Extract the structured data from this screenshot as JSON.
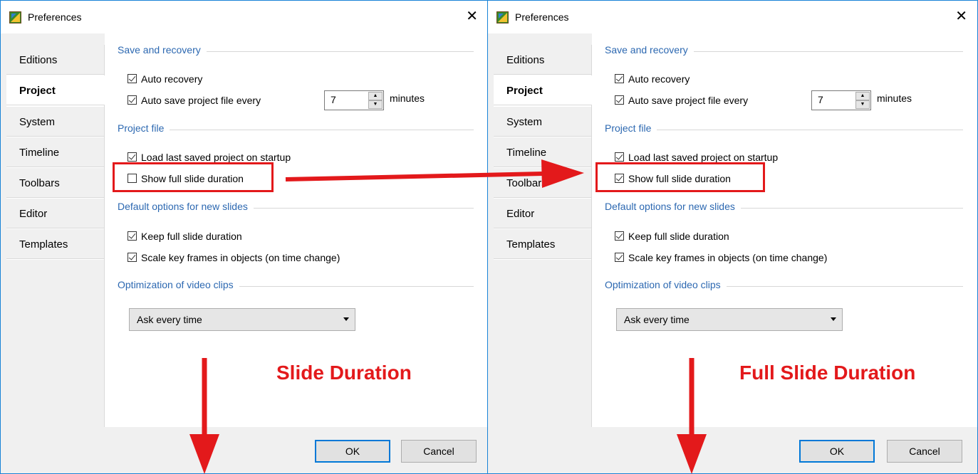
{
  "dialogs": [
    {
      "title": "Preferences",
      "tabs": [
        "Editions",
        "Project",
        "System",
        "Timeline",
        "Toolbars",
        "Editor",
        "Templates"
      ],
      "active_tab": "Project",
      "sections": {
        "save_recovery": "Save and recovery",
        "project_file": "Project file",
        "default_options": "Default options for new slides",
        "optimization": "Optimization of video clips"
      },
      "options": {
        "auto_recovery": {
          "label": "Auto recovery",
          "checked": true
        },
        "auto_save": {
          "label": "Auto save project file every",
          "checked": true
        },
        "load_last": {
          "label": "Load last saved project on startup",
          "checked": true
        },
        "show_full": {
          "label": "Show full slide duration",
          "checked": false
        },
        "keep_full": {
          "label": "Keep full slide duration",
          "checked": true
        },
        "scale_key": {
          "label": "Scale key frames in objects (on time change)",
          "checked": true
        }
      },
      "autosave_value": "7",
      "minutes_label": "minutes",
      "optimization_select": "Ask every time",
      "ok_label": "OK",
      "cancel_label": "Cancel",
      "annotation": "Slide Duration"
    },
    {
      "title": "Preferences",
      "tabs": [
        "Editions",
        "Project",
        "System",
        "Timeline",
        "Toolbars",
        "Editor",
        "Templates"
      ],
      "active_tab": "Project",
      "sections": {
        "save_recovery": "Save and recovery",
        "project_file": "Project file",
        "default_options": "Default options for new slides",
        "optimization": "Optimization of video clips"
      },
      "options": {
        "auto_recovery": {
          "label": "Auto recovery",
          "checked": true
        },
        "auto_save": {
          "label": "Auto save project file every",
          "checked": true
        },
        "load_last": {
          "label": "Load last saved project on startup",
          "checked": true
        },
        "show_full": {
          "label": "Show full slide duration",
          "checked": true
        },
        "keep_full": {
          "label": "Keep full slide duration",
          "checked": true
        },
        "scale_key": {
          "label": "Scale key frames in objects (on time change)",
          "checked": true
        }
      },
      "autosave_value": "7",
      "minutes_label": "minutes",
      "optimization_select": "Ask every time",
      "ok_label": "OK",
      "cancel_label": "Cancel",
      "annotation": "Full Slide Duration"
    }
  ],
  "colors": {
    "annotation_red": "#e3191b",
    "section_blue": "#2c68b1",
    "window_border": "#1883d7",
    "default_button_border": "#0078d7"
  },
  "icons": {
    "app": "preferences-app-icon",
    "close": "close-icon",
    "spin_up": "spin-up-icon",
    "spin_down": "spin-down-icon",
    "dropdown": "chevron-down-icon"
  }
}
